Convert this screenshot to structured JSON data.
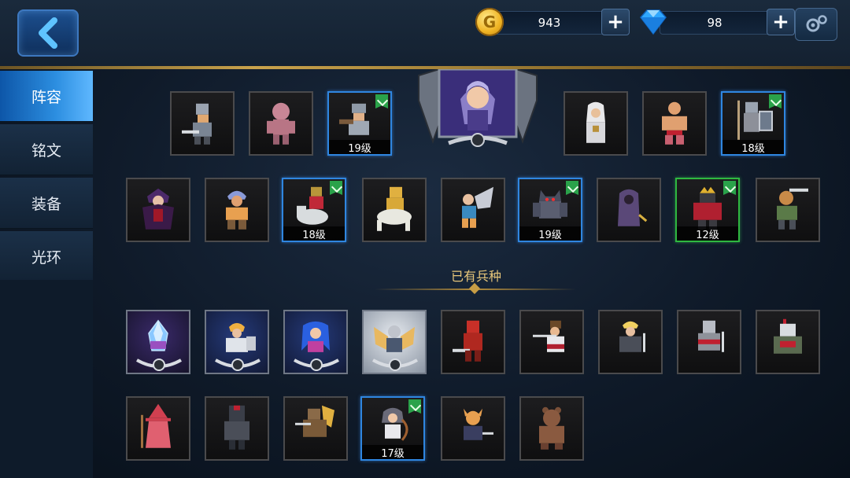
{
  "resources": {
    "gold": "943",
    "gems": "98",
    "gold_symbol": "G"
  },
  "topbar": {
    "plus_label": "+"
  },
  "sidebar": {
    "items": [
      {
        "label": "阵容"
      },
      {
        "label": "铭文"
      },
      {
        "label": "装备"
      },
      {
        "label": "光环"
      }
    ]
  },
  "lineup": {
    "slots": [
      {
        "level": ""
      },
      {
        "level": ""
      },
      {
        "level": "19级"
      },
      {
        "level": ""
      },
      {
        "level": ""
      },
      {
        "level": "18级"
      },
      {
        "level": ""
      },
      {
        "level": ""
      },
      {
        "level": "18级"
      },
      {
        "level": ""
      },
      {
        "level": ""
      },
      {
        "level": "19级"
      },
      {
        "level": ""
      },
      {
        "level": "12级"
      },
      {
        "level": ""
      }
    ]
  },
  "owned": {
    "title": "已有兵种",
    "units": [
      {
        "level": ""
      },
      {
        "level": ""
      },
      {
        "level": ""
      },
      {
        "level": ""
      },
      {
        "level": ""
      },
      {
        "level": ""
      },
      {
        "level": ""
      },
      {
        "level": ""
      },
      {
        "level": ""
      },
      {
        "level": ""
      },
      {
        "level": ""
      },
      {
        "level": ""
      },
      {
        "level": "17级"
      },
      {
        "level": ""
      },
      {
        "level": ""
      }
    ]
  },
  "colors": {
    "accent_blue": "#2f86e0",
    "accent_green": "#2fb840",
    "gold_trim": "#c9a34c"
  }
}
